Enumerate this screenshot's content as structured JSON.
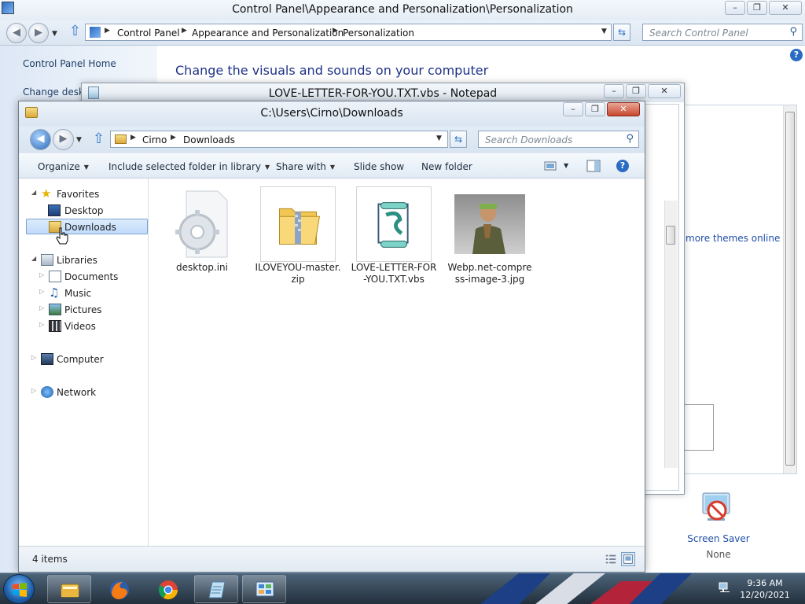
{
  "control_panel": {
    "window_title": "Control Panel\\Appearance and Personalization\\Personalization",
    "breadcrumb": [
      "Control Panel",
      "Appearance and Personalization",
      "Personalization"
    ],
    "search_placeholder": "Search Control Panel",
    "left_links": [
      "Control Panel Home",
      "Change deskto"
    ],
    "heading": "Change the visuals and sounds on your computer",
    "get_more_themes": "more themes online",
    "screen_saver": {
      "label": "Screen Saver",
      "value": "None"
    }
  },
  "notepad": {
    "window_title": "LOVE-LETTER-FOR-YOU.TXT.vbs - Notepad"
  },
  "explorer": {
    "window_title": "C:\\Users\\Cirno\\Downloads",
    "breadcrumb": [
      "Cirno",
      "Downloads"
    ],
    "search_placeholder": "Search Downloads",
    "toolbar": {
      "organize": "Organize",
      "include": "Include selected folder in library",
      "share": "Share with",
      "slideshow": "Slide show",
      "new_folder": "New folder"
    },
    "nav": {
      "favorites": "Favorites",
      "desktop": "Desktop",
      "downloads": "Downloads",
      "libraries": "Libraries",
      "documents": "Documents",
      "music": "Music",
      "pictures": "Pictures",
      "videos": "Videos",
      "computer": "Computer",
      "network": "Network"
    },
    "files": [
      {
        "name": "desktop.ini",
        "icon": "settings-file-icon"
      },
      {
        "name": "ILOVEYOU-master.zip",
        "icon": "zip-folder-icon"
      },
      {
        "name": "LOVE-LETTER-FOR-YOU.TXT.vbs",
        "icon": "script-file-icon"
      },
      {
        "name": "Webp.net-compress-image-3.jpg",
        "icon": "image-thumbnail"
      }
    ],
    "status": "4 items"
  },
  "taskbar": {
    "time": "9:36 AM",
    "date": "12/20/2021",
    "apps": [
      "windows-explorer-icon",
      "firefox-icon",
      "chrome-icon",
      "notepad-icon",
      "control-panel-icon"
    ]
  },
  "colors": {
    "link_blue": "#1f4fa8",
    "heading_blue": "#1e3287",
    "selection": "#c1dcfc",
    "taskbar": "#23303c"
  }
}
